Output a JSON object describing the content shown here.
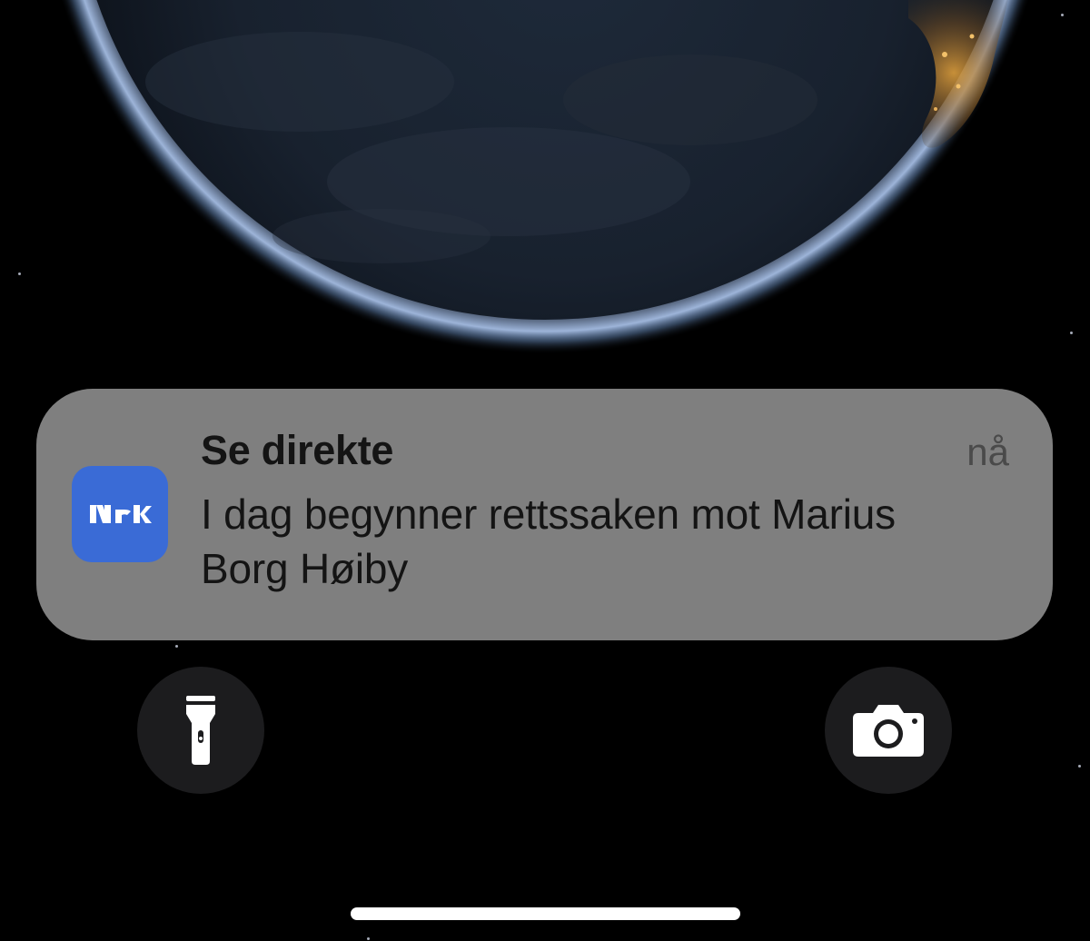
{
  "notification": {
    "app_name": "NRK",
    "app_icon": "nrk-logo-icon",
    "title": "Se direkte",
    "time": "nå",
    "body": "I dag begynner rettssaken mot Marius Borg Høiby",
    "icon_color": "#3a6bd6"
  },
  "quick_actions": {
    "flashlight_icon": "flashlight-icon",
    "camera_icon": "camera-icon"
  },
  "wallpaper": "earth-at-night"
}
